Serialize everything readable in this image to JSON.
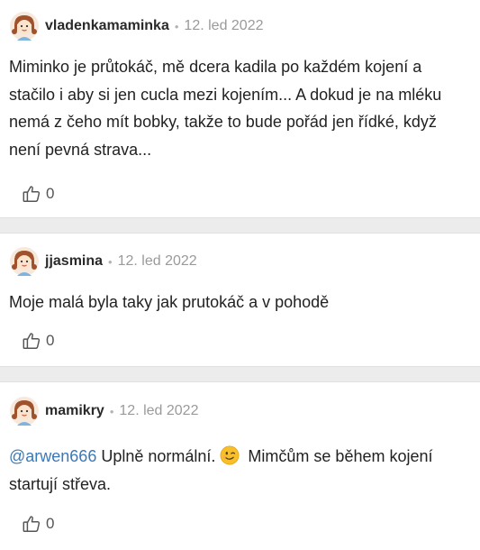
{
  "comments": [
    {
      "user": "vladenkamaminka",
      "dot": "•",
      "date": "12. led 2022",
      "text": "Miminko je průtokáč, mě dcera kadila po každém kojení a stačilo i aby si jen cucla mezi kojením... A dokud je na mléku nemá z čeho mít bobky, takže to bude pořád jen řídké, když není pevná strava...",
      "likes": "0",
      "avatar_icon": "avatar-girl-icon",
      "like_icon": "thumbs-up-icon"
    },
    {
      "user": "jjasmina",
      "dot": "•",
      "date": "12. led 2022",
      "text": "Moje malá byla taky jak prutokáč a v pohodě",
      "likes": "0",
      "avatar_icon": "avatar-girl-icon",
      "like_icon": "thumbs-up-icon"
    },
    {
      "user": "mamikry",
      "dot": "•",
      "date": "12. led 2022",
      "mention": "@arwen666",
      "text_before_emoji": " Uplně normální. ",
      "emoji_icon": "winking-face-icon",
      "text_after_emoji": " Mimčům se během kojení startují střeva.",
      "likes": "0",
      "avatar_icon": "avatar-girl-icon",
      "like_icon": "thumbs-up-icon"
    }
  ],
  "colors": {
    "mention": "#3a78b8",
    "separator": "#ececec",
    "date": "#9a9a9a"
  }
}
